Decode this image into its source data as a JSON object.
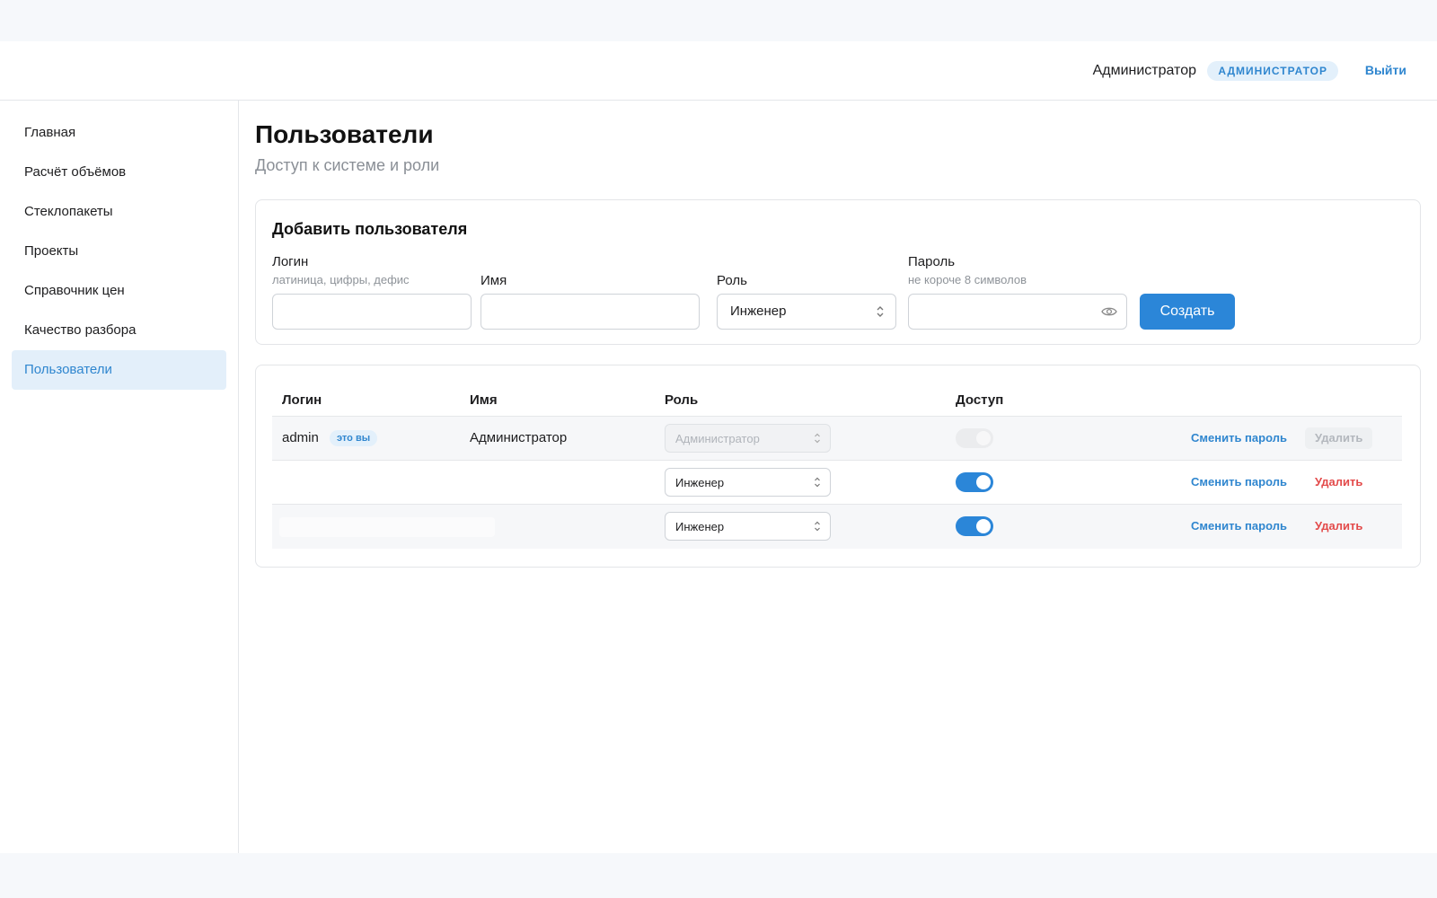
{
  "header": {
    "user_name": "Администратор",
    "role_badge": "АДМИНИСТРАТОР",
    "logout": "Выйти"
  },
  "sidebar": {
    "items": [
      {
        "label": "Главная"
      },
      {
        "label": "Расчёт объёмов"
      },
      {
        "label": "Стеклопакеты"
      },
      {
        "label": "Проекты"
      },
      {
        "label": "Справочник цен"
      },
      {
        "label": "Качество разбора"
      },
      {
        "label": "Пользователи",
        "active": true
      }
    ]
  },
  "page": {
    "title": "Пользователи",
    "subtitle": "Доступ к системе и роли"
  },
  "add_form": {
    "title": "Добавить пользователя",
    "login_label": "Логин",
    "login_hint": "латиница, цифры, дефис",
    "login_value": "",
    "name_label": "Имя",
    "name_value": "",
    "role_label": "Роль",
    "role_value": "Инженер",
    "password_label": "Пароль",
    "password_hint": "не короче 8 символов",
    "password_value": "",
    "create_button": "Создать"
  },
  "table": {
    "columns": {
      "login": "Логин",
      "name": "Имя",
      "role": "Роль",
      "access": "Доступ"
    },
    "rows": [
      {
        "login": "admin",
        "self_badge": "это вы",
        "name": "Администратор",
        "role": "Администратор",
        "access": true,
        "change_password": "Сменить пароль",
        "delete": "Удалить"
      },
      {
        "login": "",
        "name": "",
        "role": "Инженер",
        "access": true,
        "change_password": "Сменить пароль",
        "delete": "Удалить"
      },
      {
        "login": "",
        "name": "",
        "role": "Инженер",
        "access": true,
        "change_password": "Сменить пароль",
        "delete": "Удалить"
      }
    ]
  },
  "colors": {
    "accent": "#2b86d8",
    "link": "#2f86cf",
    "danger": "#e34a4a",
    "active_nav_bg": "#e3effa"
  }
}
